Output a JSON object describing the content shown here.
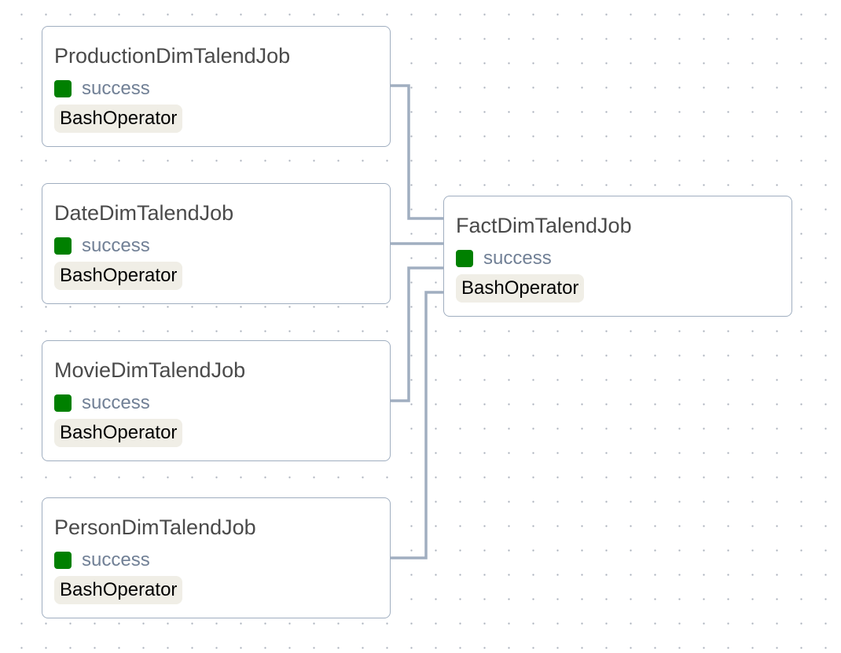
{
  "graph": {
    "status_color": "#008000",
    "edge_color": "#a0aec0",
    "nodes": [
      {
        "id": "production",
        "title": "ProductionDimTalendJob",
        "status": "success",
        "operator": "BashOperator"
      },
      {
        "id": "date",
        "title": "DateDimTalendJob",
        "status": "success",
        "operator": "BashOperator"
      },
      {
        "id": "movie",
        "title": "MovieDimTalendJob",
        "status": "success",
        "operator": "BashOperator"
      },
      {
        "id": "person",
        "title": "PersonDimTalendJob",
        "status": "success",
        "operator": "BashOperator"
      },
      {
        "id": "fact",
        "title": "FactDimTalendJob",
        "status": "success",
        "operator": "BashOperator"
      }
    ],
    "edges": [
      {
        "from": "production",
        "to": "fact"
      },
      {
        "from": "date",
        "to": "fact"
      },
      {
        "from": "movie",
        "to": "fact"
      },
      {
        "from": "person",
        "to": "fact"
      }
    ]
  }
}
